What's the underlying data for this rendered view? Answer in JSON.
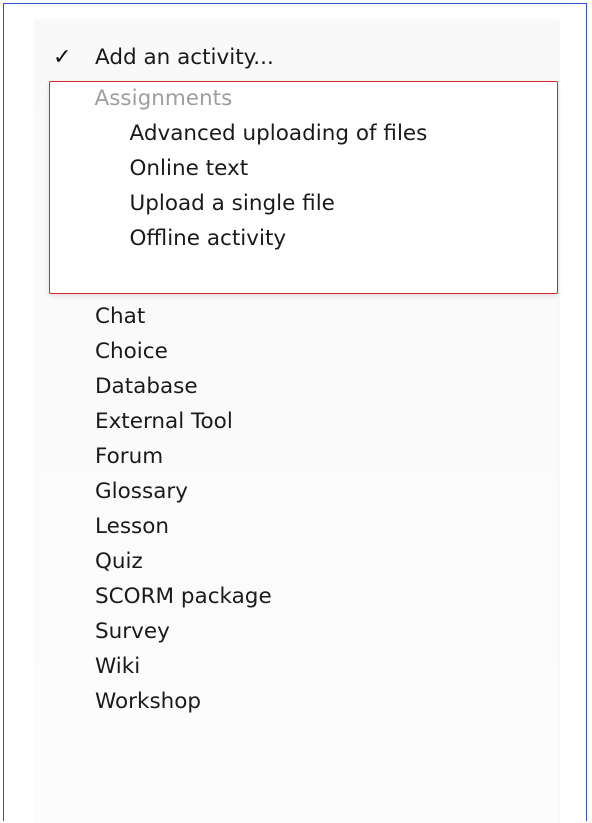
{
  "menu": {
    "selected_label": "Add an activity...",
    "check_glyph": "✓",
    "group": {
      "header": "Assignments",
      "items": [
        "Advanced uploading of files",
        "Online text",
        "Upload a single file",
        "Offline activity"
      ]
    },
    "items": [
      "Chat",
      "Choice",
      "Database",
      "External Tool",
      "Forum",
      "Glossary",
      "Lesson",
      "Quiz",
      "SCORM package",
      "Survey",
      "Wiki",
      "Workshop"
    ]
  },
  "colors": {
    "frame_border": "#2b4fd6",
    "highlight_border": "#d9262a",
    "header_text": "#9e9e9e",
    "item_text": "#1a1a1a"
  }
}
